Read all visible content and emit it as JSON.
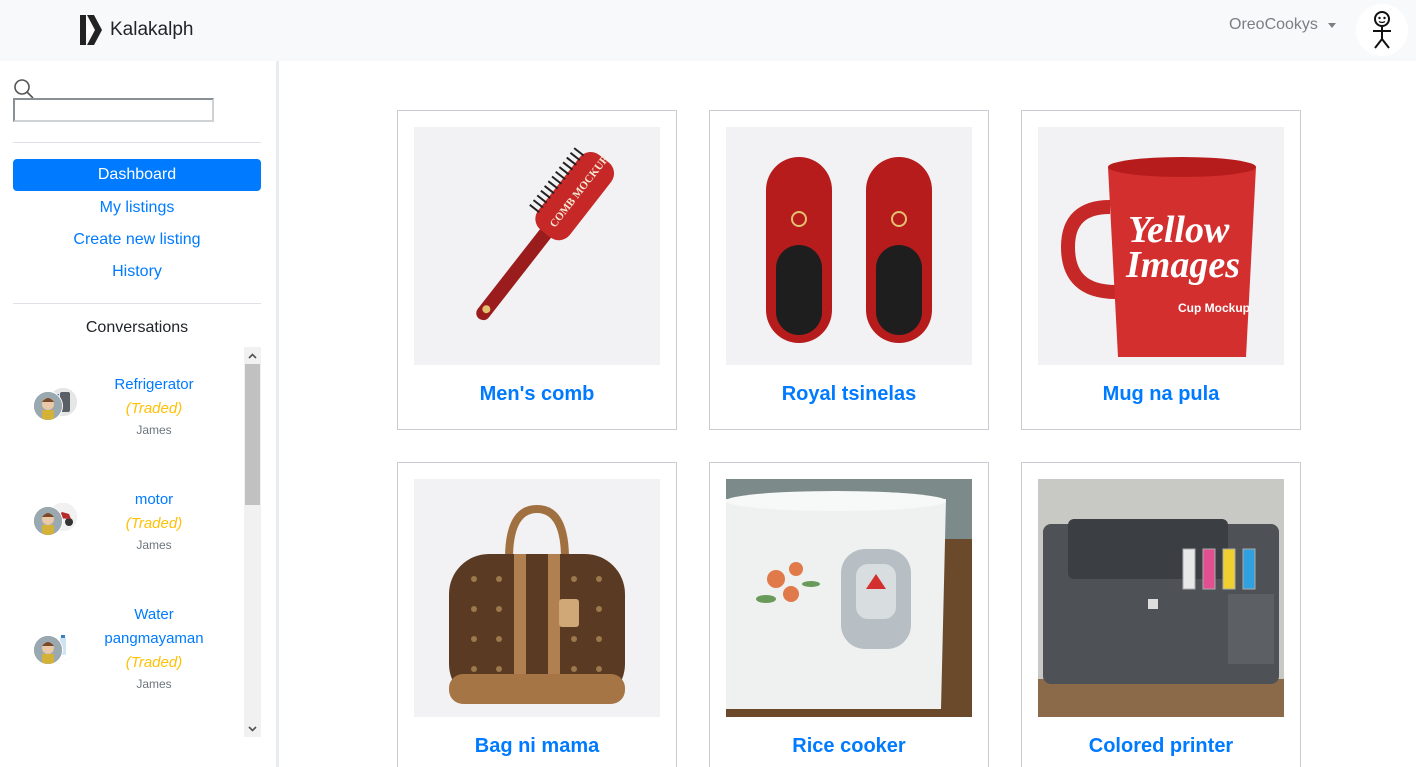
{
  "brand": {
    "name": "Kalakalph"
  },
  "user_menu": {
    "username": "OreoCookys"
  },
  "search": {
    "placeholder": ""
  },
  "sidebar": {
    "nav": [
      {
        "label": "Dashboard",
        "active": true
      },
      {
        "label": "My listings",
        "active": false
      },
      {
        "label": "Create new listing",
        "active": false
      },
      {
        "label": "History",
        "active": false
      }
    ],
    "conversations_heading": "Conversations",
    "conversations": [
      {
        "title": "Refrigerator",
        "status": "(Traded)",
        "user": "James"
      },
      {
        "title": "motor",
        "status": "(Traded)",
        "user": "James"
      },
      {
        "title": "Water pangmayaman",
        "status": "(Traded)",
        "user": "James"
      }
    ]
  },
  "listings": [
    {
      "title": "Men's comb",
      "image": "comb-photo"
    },
    {
      "title": "Royal tsinelas",
      "image": "slippers-photo"
    },
    {
      "title": "Mug na pula",
      "image": "mug-photo"
    },
    {
      "title": "Bag ni mama",
      "image": "bag-photo"
    },
    {
      "title": "Rice cooker",
      "image": "rice-cooker-photo"
    },
    {
      "title": "Colored printer",
      "image": "printer-photo"
    }
  ],
  "image_texts": {
    "comb": "COMB MOCKUP",
    "mug_line1": "Yellow",
    "mug_line2": "Images",
    "mug_sub": "Cup Mockup"
  },
  "colors": {
    "primary": "#007bff",
    "traded": "#ffc107",
    "navbar": "#f8f9fa"
  }
}
